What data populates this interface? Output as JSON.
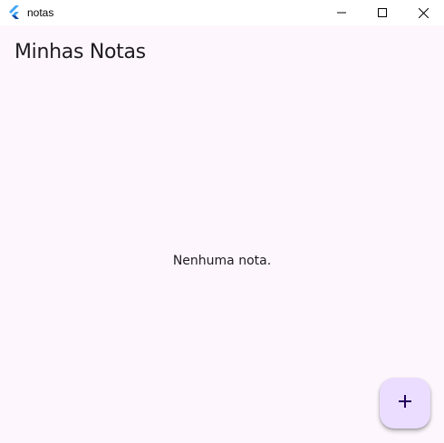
{
  "window": {
    "title": "notas",
    "app_icon": "flutter-logo-icon",
    "controls": {
      "minimize_icon": "minimize-icon",
      "maximize_icon": "maximize-icon",
      "close_icon": "close-icon"
    }
  },
  "app_bar": {
    "title": "Minhas Notas"
  },
  "main": {
    "empty_message": "Nenhuma nota."
  },
  "fab": {
    "icon": "plus-icon"
  },
  "colors": {
    "background": "#fdf7fd",
    "fab_background": "#eaddff",
    "fab_icon": "#21005d",
    "text": "#1d1b20"
  }
}
